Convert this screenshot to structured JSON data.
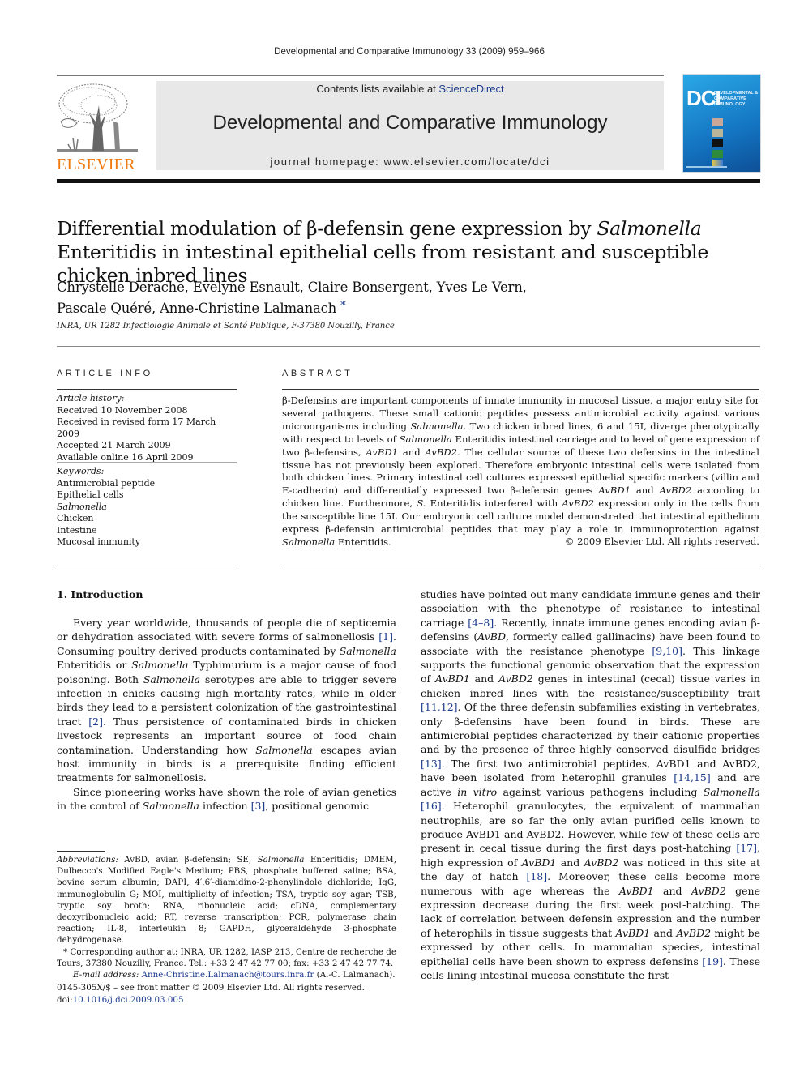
{
  "running_head": "Developmental and Comparative Immunology 33 (2009) 959–966",
  "publisher": {
    "logo_word": "ELSEVIER",
    "logo_color": "#f07a10"
  },
  "banner": {
    "contents_prefix": "Contents lists available at ",
    "contents_link": "ScienceDirect",
    "journal_name": "Developmental and Comparative Immunology",
    "homepage": "journal homepage: www.elsevier.com/locate/dci"
  },
  "cover": {
    "acronym": "DCI",
    "title_lines": [
      "DEVELOPMENTAL &",
      "COMPARATIVE",
      "IMMUNOLOGY"
    ]
  },
  "article": {
    "title_part1": "Differential modulation of β-defensin gene expression by ",
    "title_italic": "Salmonella",
    "title_part2": " Enteritidis in intestinal epithelial cells from resistant and susceptible chicken inbred lines",
    "authors_line1": "Chrystelle Derache, Evelyne Esnault, Claire Bonsergent, Yves Le Vern,",
    "authors_line2": "Pascale Quéré, Anne-Christine Lalmanach",
    "corresponding_mark": "*",
    "affiliation": "INRA, UR 1282 Infectiologie Animale et Santé Publique, F-37380 Nouzilly, France"
  },
  "article_info": {
    "heading": "ARTICLE INFO",
    "history_label": "Article history:",
    "history": [
      "Received 10 November 2008",
      "Received in revised form 17 March 2009",
      "Accepted 21 March 2009",
      "Available online 16 April 2009"
    ],
    "keywords_label": "Keywords:",
    "keywords": [
      {
        "text": "Antimicrobial peptide",
        "italic": false
      },
      {
        "text": "Epithelial cells",
        "italic": false
      },
      {
        "text": "Salmonella",
        "italic": true
      },
      {
        "text": "Chicken",
        "italic": false
      },
      {
        "text": "Intestine",
        "italic": false
      },
      {
        "text": "Mucosal immunity",
        "italic": false
      }
    ]
  },
  "abstract": {
    "heading": "ABSTRACT",
    "s1": "β-Defensins are important components of innate immunity in mucosal tissue, a major entry site for several pathogens. These small cationic peptides possess antimicrobial activity against various microorganisms including ",
    "i1": "Salmonella",
    "s2": ". Two chicken inbred lines, 6 and 15I, diverge phenotypically with respect to levels of ",
    "i2": "Salmonella",
    "s3": " Enteritidis intestinal carriage and to level of gene expression of two β-defensins, ",
    "i3": "AvBD1",
    "s4": " and ",
    "i4": "AvBD2",
    "s5": ". The cellular source of these two defensins in the intestinal tissue has not previously been explored. Therefore embryonic intestinal cells were isolated from both chicken lines. Primary intestinal cell cultures expressed epithelial specific markers (villin and E-cadherin) and differentially expressed two β-defensin genes ",
    "i5": "AvBD1",
    "s6": " and ",
    "i6": "AvBD2",
    "s7": " according to chicken line. Furthermore, ",
    "i7": "S.",
    "s8": " Enteritidis interfered with ",
    "i8": "AvBD2",
    "s9": " expression only in the cells from the susceptible line 15I. Our embryonic cell culture model demonstrated that intestinal epithelium express β-defensin antimicrobial peptides that may play a role in immunoprotection against ",
    "i9": "Salmonella",
    "s10": " Enteritidis.",
    "copyright": "© 2009 Elsevier Ltd. All rights reserved."
  },
  "introduction": {
    "heading": "1. Introduction",
    "p1": {
      "a": "Every year worldwide, thousands of people die of septicemia or dehydration associated with severe forms of salmonellosis ",
      "r1": "[1]",
      "b": ". Consuming poultry derived products contaminated by ",
      "i1": "Salmonella",
      "c": " Enteritidis or ",
      "i2": "Salmonella",
      "d": " Typhimurium is a major cause of food poisoning. Both ",
      "i3": "Salmonella",
      "e": " serotypes are able to trigger severe infection in chicks causing high mortality rates, while in older birds they lead to a persistent colonization of the gastrointestinal tract ",
      "r2": "[2]",
      "f": ". Thus persistence of contaminated birds in chicken livestock represents an important source of food chain contamination. Understanding how ",
      "i4": "Salmonella",
      "g": " escapes avian host immunity in birds is a prerequisite finding efficient treatments for salmonel­losis."
    },
    "p2": {
      "a": "Since pioneering works have shown the role of avian genetics in the control of ",
      "i1": "Salmonella",
      "b": " infection ",
      "r1": "[3]",
      "c": ", positional genomic studies have pointed out many candidate immune genes and their association with the phenotype of resistance to intestinal carriage ",
      "r2": "[4–8]",
      "d": ". Recently, innate immune genes encoding avian β-defensins (",
      "i2": "AvBD",
      "e": ", formerly called gallinacins) have been found to associate with the resistance phenotype ",
      "r3": "[9,10]",
      "f": ". This linkage supports the functional genomic observation that the expression of ",
      "i3": "AvBD1",
      "g": " and ",
      "i4": "AvBD2",
      "h": " genes in intestinal (cecal) tissue varies in chicken inbred lines with the resistance/susceptibility trait ",
      "r4": "[11,12]",
      "j": ". Of the three defensin subfamilies existing in vertebrates, only β-defensins have been found in birds. These are antimicrobial peptides characterized by their cationic properties and by the presence of three highly conserved disulfide bridges ",
      "r5": "[13]",
      "k": ". The first two antimicrobial peptides, AvBD1 and AvBD2, have been isolated from heterophil granules ",
      "r6": "[14,15]",
      "l": " and are active ",
      "i5": "in vitro",
      "m": " against various pathogens including ",
      "i6": "Salmonella",
      "n": " ",
      "r7": "[16]",
      "o": ". Heterophil granu­locytes, the equivalent of mammalian neutrophils, are so far the only avian purified cells known to produce AvBD1 and AvBD2. However, while few of these cells are present in cecal tissue during the first days post-hatching ",
      "r8": "[17]",
      "p": ", high expression of ",
      "i7": "AvBD1",
      "q": " and ",
      "i8": "AvBD2",
      "s": " was noticed in this site at the day of hatch ",
      "r9": "[18]",
      "t": ". Moreover, these cells become more numerous with age whereas the ",
      "i9": "AvBD1",
      "u": " and ",
      "i10": "AvBD2",
      "v": " gene expression decrease during the first week post-hatching. The lack of correlation between defensin expression and the number of heterophils in tissue suggests that ",
      "i11": "AvBD1",
      "w": " and ",
      "i12": "AvBD2",
      "x": " might be expressed by other cells. In mammalian species, intestinal epithelial cells have been shown to express defensins ",
      "r10": "[19]",
      "y": ". These cells lining intestinal mucosa constitute the first"
    }
  },
  "footnotes": {
    "abbr_label": "Abbreviations:",
    "abbr_a": " AvBD, avian β-defensin; SE, ",
    "abbr_i": "Salmonella",
    "abbr_b": " Enteritidis; DMEM, Dulbec­co's Modified Eagle's Medium; PBS, phosphate buffered saline; BSA, bovine serum albumin; DAPI, 4′,6′-diamidino-2-phenylindole dichloride; IgG, immunoglobulin G; MOI, multiplicity of infection; TSA, tryptic soy agar; TSB, tryptic soy broth; RNA, ribonucleic acid; cDNA, complementary deoxyribonucleic acid; RT, reverse transcription; PCR, polymerase chain reaction; IL-8, interleukin 8; GAPDH, glyceraldehyde 3-phosphate dehydrogenase.",
    "corresponding": "* Corresponding author at: INRA, UR 1282, IASP 213, Centre de recherche de Tours, 37380 Nouzilly, France. Tel.: +33 2 47 42 77 00; fax: +33 2 47 42 77 74.",
    "email_label": "E-mail address:",
    "email": "Anne-Christine.Lalmanach@tours.inra.fr",
    "email_suffix": " (A.-C. Lalmanach)."
  },
  "front_matter": {
    "issn_line": "0145-305X/$ – see front matter © 2009 Elsevier Ltd. All rights reserved.",
    "doi_prefix": "doi:",
    "doi": "10.1016/j.dci.2009.03.005"
  },
  "colors": {
    "link": "#1b3a8c",
    "banner_bg": "#e8e8e8",
    "cover_blue": "#1475c2"
  }
}
